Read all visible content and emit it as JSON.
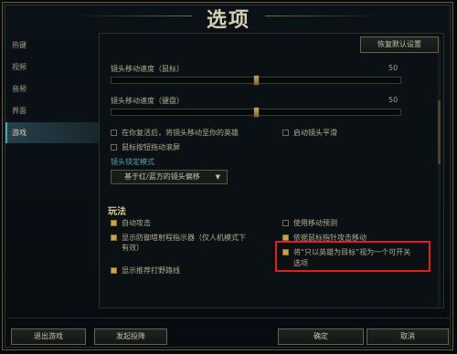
{
  "window": {
    "title": "选项"
  },
  "sidebar": {
    "items": [
      {
        "label": "热键",
        "active": false
      },
      {
        "label": "视频",
        "active": false
      },
      {
        "label": "音频",
        "active": false
      },
      {
        "label": "界面",
        "active": false
      },
      {
        "label": "游戏",
        "active": true
      }
    ]
  },
  "toolbar": {
    "restore_defaults": "恢复默认设置"
  },
  "camera": {
    "mouse_speed_label": "镜头移动速度（鼠标）",
    "mouse_speed_value": "50",
    "mouse_speed_fraction": 0.5,
    "keyboard_speed_label": "镜头移动速度（键盘）",
    "keyboard_speed_value": "50",
    "keyboard_speed_fraction": 0.5,
    "checkboxes": [
      {
        "label": "在你复活后，将镜头移动至你的英雄",
        "checked": false
      },
      {
        "label": "启动镜头平滑",
        "checked": false
      },
      {
        "label": "鼠标按钮拖动滚屏",
        "checked": false
      }
    ],
    "lock_mode_label": "镜头锁定模式",
    "lock_mode_selected": "基于红/蓝方的镜头偏移"
  },
  "gameplay": {
    "section_title": "玩法",
    "options": [
      {
        "label": "自动攻击",
        "checked": true
      },
      {
        "label": "使用移动预测",
        "checked": false
      },
      {
        "label_line1": "显示防御塔射程指示器（仅人机模式下",
        "label_line2": "有效）",
        "checked": true
      },
      {
        "label": "依据鼠标指针攻击移动",
        "checked": true
      },
      {
        "label_line1": "将“只以英雄为目标”视为一个可开关",
        "label_line2": "选项",
        "checked": true
      },
      {
        "label": "显示推荐打野路线",
        "checked": true
      }
    ]
  },
  "footer": {
    "exit_game": "退出游戏",
    "surrender": "发起投降",
    "ok": "确定",
    "cancel": "取消"
  },
  "colors": {
    "accent_gold": "#c9a44b",
    "section_blue": "#5f9dae",
    "highlight_red": "#e02020"
  }
}
